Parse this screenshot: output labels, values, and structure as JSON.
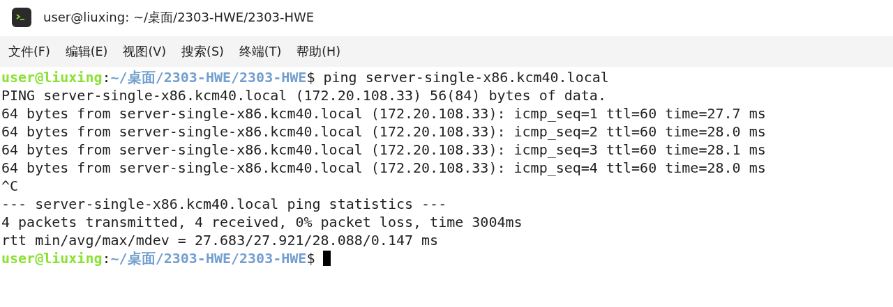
{
  "window": {
    "title": "user@liuxing: ~/桌面/2303-HWE/2303-HWE"
  },
  "menu": [
    {
      "label": "文件(F)"
    },
    {
      "label": "编辑(E)"
    },
    {
      "label": "视图(V)"
    },
    {
      "label": "搜索(S)"
    },
    {
      "label": "终端(T)"
    },
    {
      "label": "帮助(H)"
    }
  ],
  "terminal": {
    "lines": [
      {
        "kind": "prompt",
        "user": "user@liuxing",
        "separator": ":",
        "path": "~/桌面/2303-HWE/2303-HWE",
        "symbol": "$",
        "command": "ping server-single-x86.kcm40.local"
      },
      {
        "kind": "output",
        "text": "PING server-single-x86.kcm40.local (172.20.108.33) 56(84) bytes of data."
      },
      {
        "kind": "output",
        "text": "64 bytes from server-single-x86.kcm40.local (172.20.108.33): icmp_seq=1 ttl=60 time=27.7 ms"
      },
      {
        "kind": "output",
        "text": "64 bytes from server-single-x86.kcm40.local (172.20.108.33): icmp_seq=2 ttl=60 time=28.0 ms"
      },
      {
        "kind": "output",
        "text": "64 bytes from server-single-x86.kcm40.local (172.20.108.33): icmp_seq=3 ttl=60 time=28.1 ms"
      },
      {
        "kind": "output",
        "text": "64 bytes from server-single-x86.kcm40.local (172.20.108.33): icmp_seq=4 ttl=60 time=28.0 ms"
      },
      {
        "kind": "output",
        "text": "^C"
      },
      {
        "kind": "output",
        "text": "--- server-single-x86.kcm40.local ping statistics ---"
      },
      {
        "kind": "output",
        "text": "4 packets transmitted, 4 received, 0% packet loss, time 3004ms"
      },
      {
        "kind": "output",
        "text": "rtt min/avg/max/mdev = 27.683/27.921/28.088/0.147 ms"
      },
      {
        "kind": "prompt",
        "user": "user@liuxing",
        "separator": ":",
        "path": "~/桌面/2303-HWE/2303-HWE",
        "symbol": "$",
        "cursor": true
      }
    ]
  }
}
